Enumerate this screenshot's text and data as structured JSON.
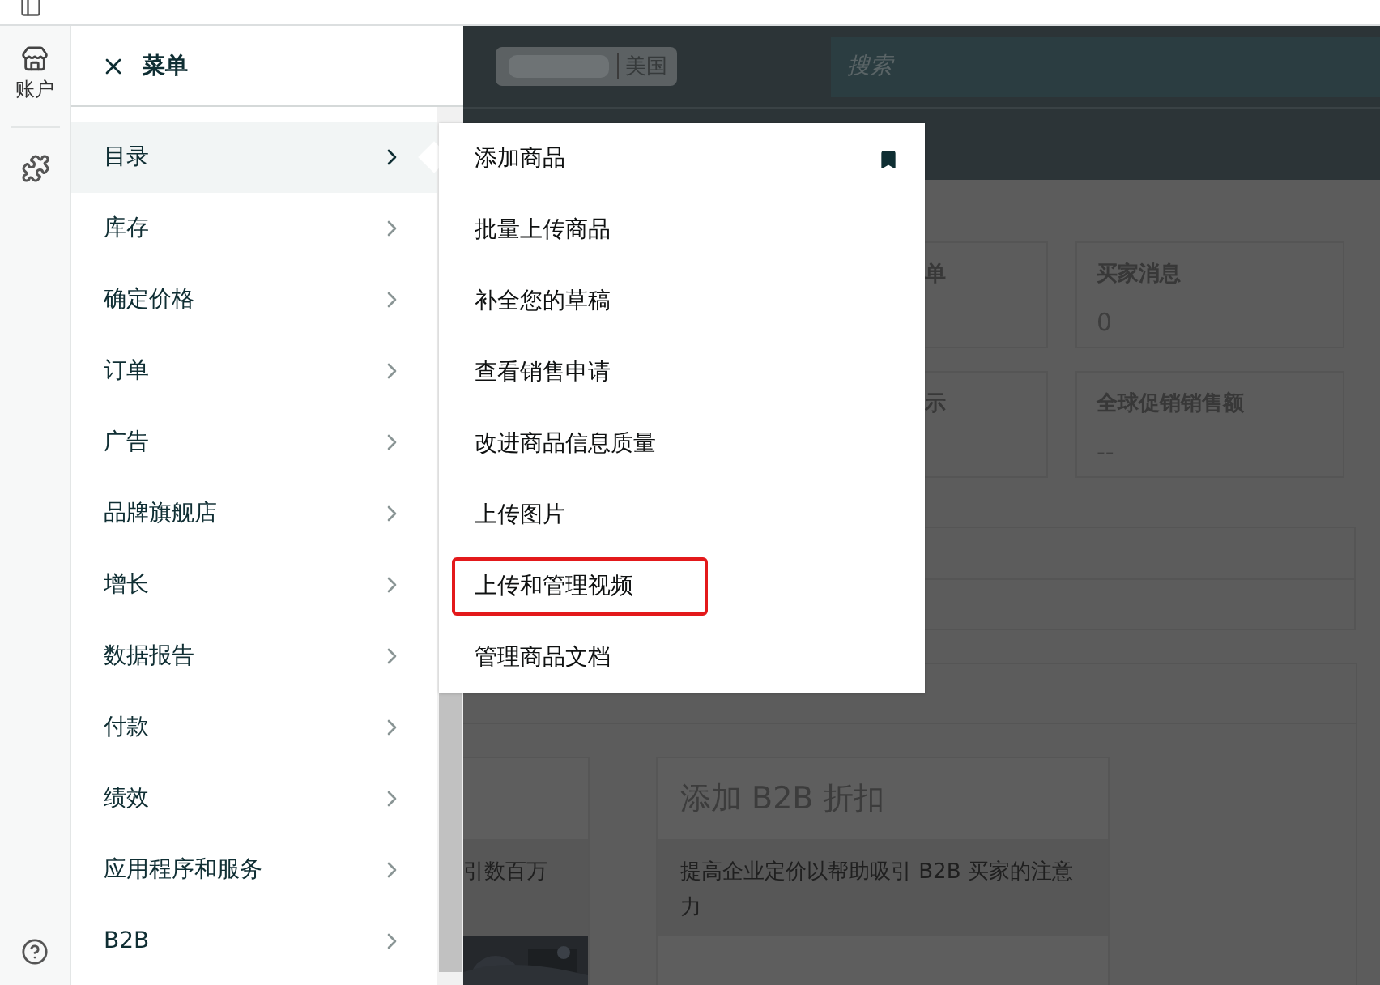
{
  "rail": {
    "account_label": "账户"
  },
  "menu": {
    "title": "菜单",
    "items": [
      {
        "label": "目录",
        "selected": true
      },
      {
        "label": "库存",
        "selected": false
      },
      {
        "label": "确定价格",
        "selected": false
      },
      {
        "label": "订单",
        "selected": false
      },
      {
        "label": "广告",
        "selected": false
      },
      {
        "label": "品牌旗舰店",
        "selected": false
      },
      {
        "label": "增长",
        "selected": false
      },
      {
        "label": "数据报告",
        "selected": false
      },
      {
        "label": "付款",
        "selected": false
      },
      {
        "label": "绩效",
        "selected": false
      },
      {
        "label": "应用程序和服务",
        "selected": false
      },
      {
        "label": "B2B",
        "selected": false
      }
    ]
  },
  "submenu": {
    "items": [
      {
        "label": "添加商品",
        "bookmarked": true,
        "highlighted": false
      },
      {
        "label": "批量上传商品",
        "bookmarked": false,
        "highlighted": false
      },
      {
        "label": "补全您的草稿",
        "bookmarked": false,
        "highlighted": false
      },
      {
        "label": "查看销售申请",
        "bookmarked": false,
        "highlighted": false
      },
      {
        "label": "改进商品信息质量",
        "bookmarked": false,
        "highlighted": false
      },
      {
        "label": "上传图片",
        "bookmarked": false,
        "highlighted": false
      },
      {
        "label": "上传和管理视频",
        "bookmarked": false,
        "highlighted": true
      },
      {
        "label": "管理商品文档",
        "bookmarked": false,
        "highlighted": false
      }
    ]
  },
  "header": {
    "marketplace": "美国",
    "search": {
      "placeholder": "搜索"
    }
  },
  "stats": [
    [
      {
        "label": "单"
      },
      {
        "label": "买家消息",
        "value": "0"
      }
    ],
    [
      {
        "label": "示"
      },
      {
        "label": "全球促销销售额",
        "value": "--"
      }
    ]
  ],
  "promos": [
    {
      "description": "引数百万",
      "kind": "picture"
    },
    {
      "title": "添加 B2B 折扣",
      "description": "提高企业定价以帮助吸引 B2B 买家的注意力",
      "kind": "plain"
    }
  ]
}
